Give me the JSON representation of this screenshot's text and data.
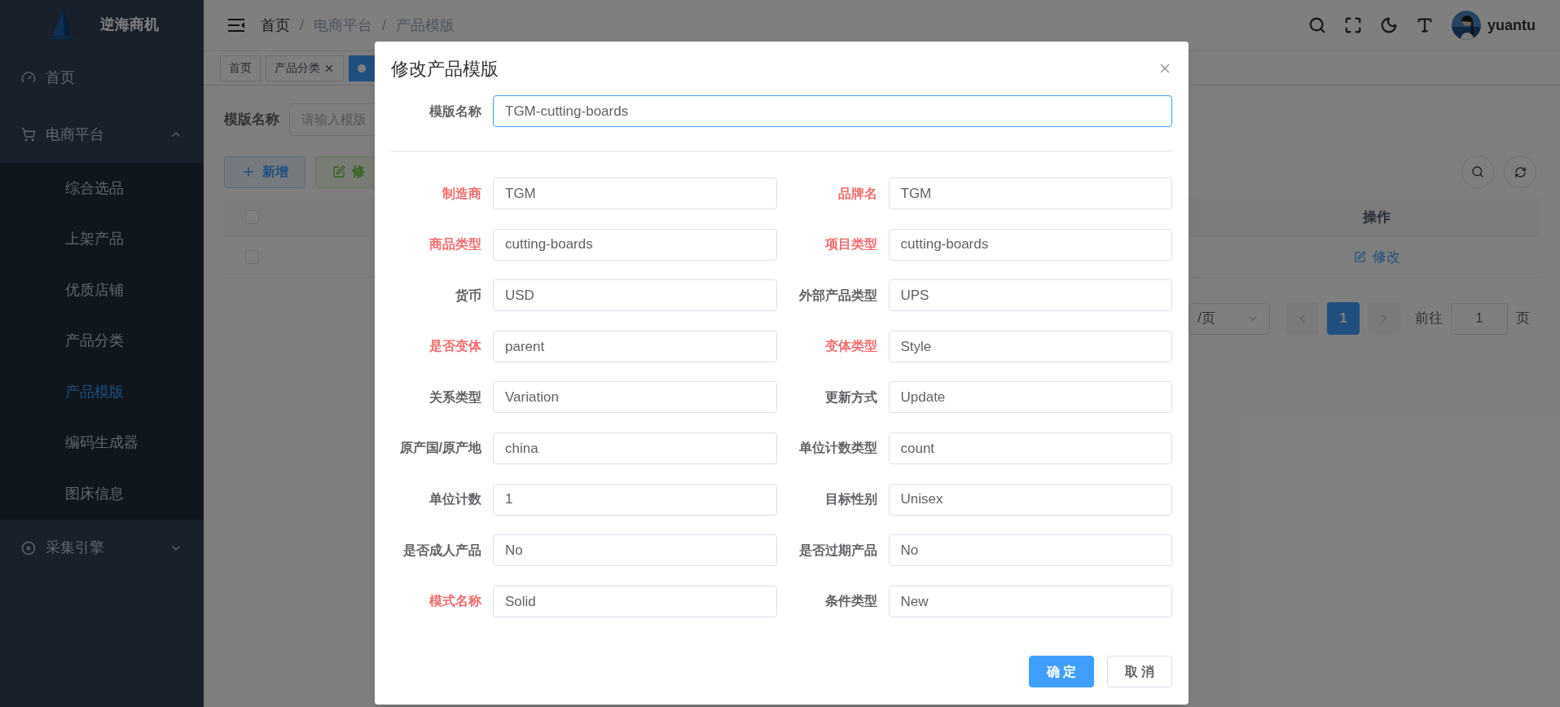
{
  "sidebar": {
    "logo_text": "逆海商机",
    "items": [
      {
        "label": "首页",
        "kind": "link",
        "selected": false
      },
      {
        "label": "电商平台",
        "kind": "group",
        "expanded": true,
        "children": [
          {
            "label": "综合选品",
            "selected": false
          },
          {
            "label": "上架产品",
            "selected": false
          },
          {
            "label": "优质店铺",
            "selected": false
          },
          {
            "label": "产品分类",
            "selected": false
          },
          {
            "label": "产品模版",
            "selected": true
          },
          {
            "label": "编码生成器",
            "selected": false
          },
          {
            "label": "图床信息",
            "selected": false
          }
        ]
      },
      {
        "label": "采集引擎",
        "kind": "group",
        "expanded": false
      }
    ]
  },
  "header": {
    "breadcrumb": [
      "首页",
      "电商平台",
      "产品模版"
    ],
    "separator": "/",
    "user": "yuantu"
  },
  "tags": [
    {
      "label": "首页",
      "closable": false,
      "selected": false
    },
    {
      "label": "产品分类",
      "closable": true,
      "selected": false
    },
    {
      "selected": true
    }
  ],
  "search": {
    "label": "模版名称",
    "placeholder": "请输入模版"
  },
  "toolbar": [
    {
      "label": "新增",
      "kind": "add"
    },
    {
      "label": "修",
      "kind": "edit"
    }
  ],
  "table": {
    "columns": [
      "操作"
    ],
    "header_checked": false,
    "rows": [
      {
        "checked": false,
        "action": "修改"
      }
    ]
  },
  "pagination": {
    "page_size": "/页",
    "pages": [
      {
        "label": "1",
        "selected": true
      }
    ],
    "goto_label": "前往",
    "goto_value": "1",
    "page_suffix": "页"
  },
  "dialog": {
    "title": "修改产品模版",
    "name_field": {
      "label": "模版名称",
      "value": "TGM-cutting-boards",
      "focused": true
    },
    "fields": [
      {
        "label": "制造商",
        "value": "TGM",
        "required": true
      },
      {
        "label": "品牌名",
        "value": "TGM",
        "required": true
      },
      {
        "label": "商品类型",
        "value": "cutting-boards",
        "required": true
      },
      {
        "label": "项目类型",
        "value": "cutting-boards",
        "required": true
      },
      {
        "label": "货币",
        "value": "USD",
        "required": false
      },
      {
        "label": "外部产品类型",
        "value": "UPS",
        "required": false
      },
      {
        "label": "是否变体",
        "value": "parent",
        "required": true
      },
      {
        "label": "变体类型",
        "value": "Style",
        "required": true
      },
      {
        "label": "关系类型",
        "value": "Variation",
        "required": false
      },
      {
        "label": "更新方式",
        "value": "Update",
        "required": false
      },
      {
        "label": "原产国/原产地",
        "value": "china",
        "required": false
      },
      {
        "label": "单位计数类型",
        "value": "count",
        "required": false
      },
      {
        "label": "单位计数",
        "value": "1",
        "required": false
      },
      {
        "label": "目标性别",
        "value": "Unisex",
        "required": false
      },
      {
        "label": "是否成人产品",
        "value": "No",
        "required": false
      },
      {
        "label": "是否过期产品",
        "value": "No",
        "required": false
      },
      {
        "label": "模式名称",
        "value": "Solid",
        "required": true
      },
      {
        "label": "条件类型",
        "value": "New",
        "required": false
      }
    ],
    "buttons": [
      {
        "label": "确 定",
        "kind": "primary"
      },
      {
        "label": "取 消",
        "kind": "default"
      }
    ]
  }
}
